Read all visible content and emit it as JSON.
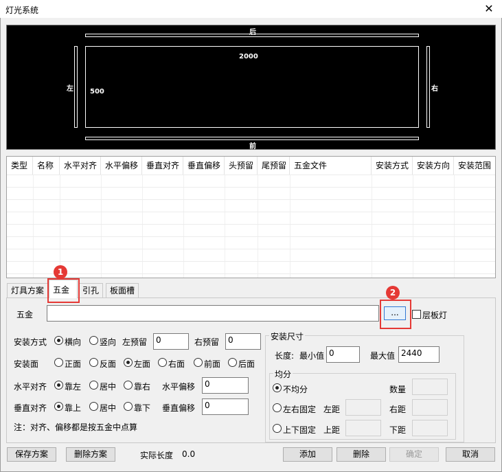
{
  "window": {
    "title": "灯光系统",
    "close_glyph": "✕"
  },
  "preview": {
    "label_back": "后",
    "label_front": "前",
    "label_left": "左",
    "label_right": "右",
    "width_value": "2000",
    "depth_value": "500"
  },
  "table": {
    "columns": [
      "类型",
      "名称",
      "水平对齐",
      "水平偏移",
      "垂直对齐",
      "垂直偏移",
      "头预留",
      "尾预留",
      "五金文件",
      "安装方式",
      "安装方向",
      "安装范围"
    ]
  },
  "tabs": [
    "灯具方案",
    "五金",
    "引孔",
    "板面槽"
  ],
  "badges": [
    "1",
    "2"
  ],
  "hardware": {
    "label": "五金",
    "value": "",
    "browse_label": "...",
    "layer_light_label": "层板灯"
  },
  "install": {
    "mode_label": "安装方式",
    "mode_options": [
      "横向",
      "竖向"
    ],
    "left_reserve_label": "左预留",
    "left_reserve_value": "0",
    "right_reserve_label": "右预留",
    "right_reserve_value": "0",
    "face_label": "安装面",
    "face_options": [
      "正面",
      "反面",
      "左面",
      "右面",
      "前面",
      "后面"
    ],
    "h_align_label": "水平对齐",
    "h_align_options": [
      "靠左",
      "居中",
      "靠右"
    ],
    "h_offset_label": "水平偏移",
    "h_offset_value": "0",
    "v_align_label": "垂直对齐",
    "v_align_options": [
      "靠上",
      "居中",
      "靠下"
    ],
    "v_offset_label": "垂直偏移",
    "v_offset_value": "0",
    "note": "注：对齐、偏移都是按五金中点算"
  },
  "size": {
    "group_label": "安装尺寸",
    "length_label": "长度:",
    "min_label": "最小值",
    "min_value": "0",
    "max_label": "最大值",
    "max_value": "2440",
    "split_label": "均分",
    "opt_uneven": "不均分",
    "count_label": "数量",
    "opt_lr_fixed": "左右固定",
    "left_dist_label": "左距",
    "right_dist_label": "右距",
    "opt_tb_fixed": "上下固定",
    "top_dist_label": "上距",
    "bottom_dist_label": "下距"
  },
  "footer": {
    "save_label": "保存方案",
    "delete_scheme_label": "删除方案",
    "actual_length_label": "实际长度",
    "actual_length_value": "0.0",
    "add_label": "添加",
    "delete_label": "删除",
    "confirm_label": "确定",
    "cancel_label": "取消"
  }
}
